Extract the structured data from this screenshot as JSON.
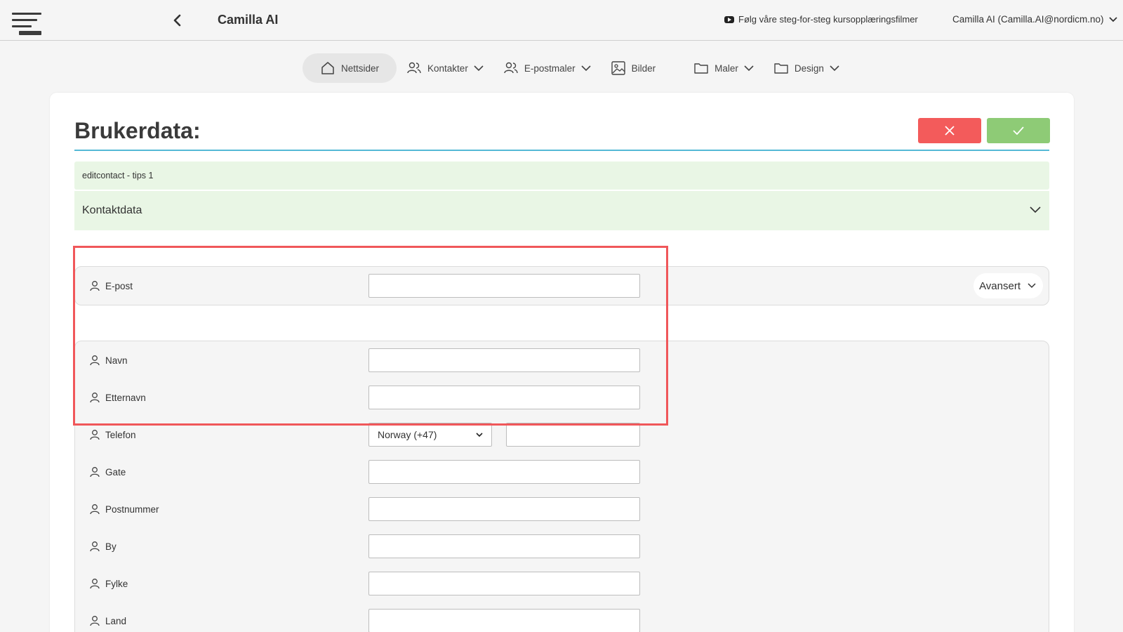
{
  "header": {
    "app_title": "Camilla AI",
    "tutorial_link": "Følg våre steg-for-steg kursopplæringsfilmer",
    "user_menu": "Camilla AI (Camilla.AI@nordicm.no)"
  },
  "nav": {
    "items": [
      {
        "label": "Nettsider",
        "icon": "home-icon",
        "active": true
      },
      {
        "label": "Kontakter",
        "icon": "users-icon",
        "dropdown": true
      },
      {
        "label": "E-postmaler",
        "icon": "users-icon",
        "dropdown": true
      },
      {
        "label": "Bilder",
        "icon": "image-icon"
      },
      {
        "label": "Maler",
        "icon": "folder-icon",
        "dropdown": true
      },
      {
        "label": "Design",
        "icon": "folder-icon",
        "dropdown": true
      }
    ]
  },
  "page": {
    "title": "Brukerdata:",
    "tips": "editcontact - tips 1",
    "section_title": "Kontaktdata",
    "advanced_label": "Avansert"
  },
  "colors": {
    "cancel": "#f35b5b",
    "confirm": "#8ecb76",
    "accent_rule": "#54b9d6",
    "tips_bg": "#e9f6e5",
    "highlight": "#f0575a"
  },
  "form": {
    "email_label": "E-post",
    "email_value": "",
    "name_label": "Navn",
    "lastname_label": "Etternavn",
    "phone_label": "Telefon",
    "phone_country": "Norway (+47)",
    "street_label": "Gate",
    "postal_label": "Postnummer",
    "city_label": "By",
    "county_label": "Fylke",
    "country_label": "Land"
  }
}
